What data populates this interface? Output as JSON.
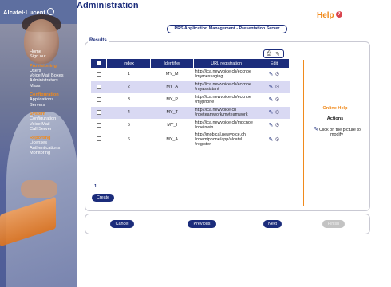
{
  "brand": "Alcatel·Lucent",
  "page_title": "Administration",
  "help_label": "Help",
  "subtitle": "PRS Application Management - Presentation Server",
  "results_label": "Results",
  "nav": [
    {
      "label": "Home",
      "type": "item"
    },
    {
      "label": "Sign out",
      "type": "item"
    },
    {
      "label": "Provisioning",
      "type": "section"
    },
    {
      "label": "Users",
      "type": "item"
    },
    {
      "label": "Voice Mail Boxes",
      "type": "item"
    },
    {
      "label": "Administrators",
      "type": "item"
    },
    {
      "label": "Mass",
      "type": "item"
    },
    {
      "label": "Configuration",
      "type": "section"
    },
    {
      "label": "Applications",
      "type": "item"
    },
    {
      "label": "Servers",
      "type": "item"
    },
    {
      "label": "System",
      "type": "section"
    },
    {
      "label": "Configuration",
      "type": "item"
    },
    {
      "label": "Voice Mail",
      "type": "item"
    },
    {
      "label": "Call Server",
      "type": "item"
    },
    {
      "label": "Reporting",
      "type": "section"
    },
    {
      "label": "Licenses",
      "type": "item"
    },
    {
      "label": "Authentications",
      "type": "item"
    },
    {
      "label": "Monitoring",
      "type": "item"
    }
  ],
  "table": {
    "headers": [
      "",
      "Index",
      "Identifier",
      "URL registration",
      "Edit"
    ],
    "rows": [
      {
        "index": "1",
        "identifier": "MY_M",
        "url": [
          "http://ica.newvoice.ch/eccnoe",
          "/mymessaging"
        ]
      },
      {
        "index": "2",
        "identifier": "MY_A",
        "url": [
          "http://ica.newvoice.ch/eccnoe",
          "/myassistant"
        ]
      },
      {
        "index": "3",
        "identifier": "MY_P",
        "url": [
          "http://ica.newvoice.ch/eccnoe",
          "/myphone"
        ]
      },
      {
        "index": "4",
        "identifier": "MY_T",
        "url": [
          "http://ica.newvoice.ch",
          "/noeteamwork/myteamwork"
        ]
      },
      {
        "index": "5",
        "identifier": "MY_I",
        "url": [
          "http://ica.newvoice.ch/mpcnoe",
          "/noeinwin"
        ]
      },
      {
        "index": "6",
        "identifier": "MY_A",
        "url": [
          "http://mobical.newvoice.ch",
          "/noemiphone/app/alcatel",
          "/register"
        ]
      }
    ]
  },
  "pagination": "1",
  "buttons": {
    "create": "Create",
    "cancel": "Cancel",
    "previous": "Previous",
    "next": "Next",
    "finish": "Finish"
  },
  "online_help": {
    "title": "Online Help",
    "actions": "Actions",
    "text": "Click on the picture to modify"
  },
  "colors": {
    "navy": "#1b2c7b",
    "orange": "#f08a1c",
    "row_alt": "#d9d9f3"
  }
}
